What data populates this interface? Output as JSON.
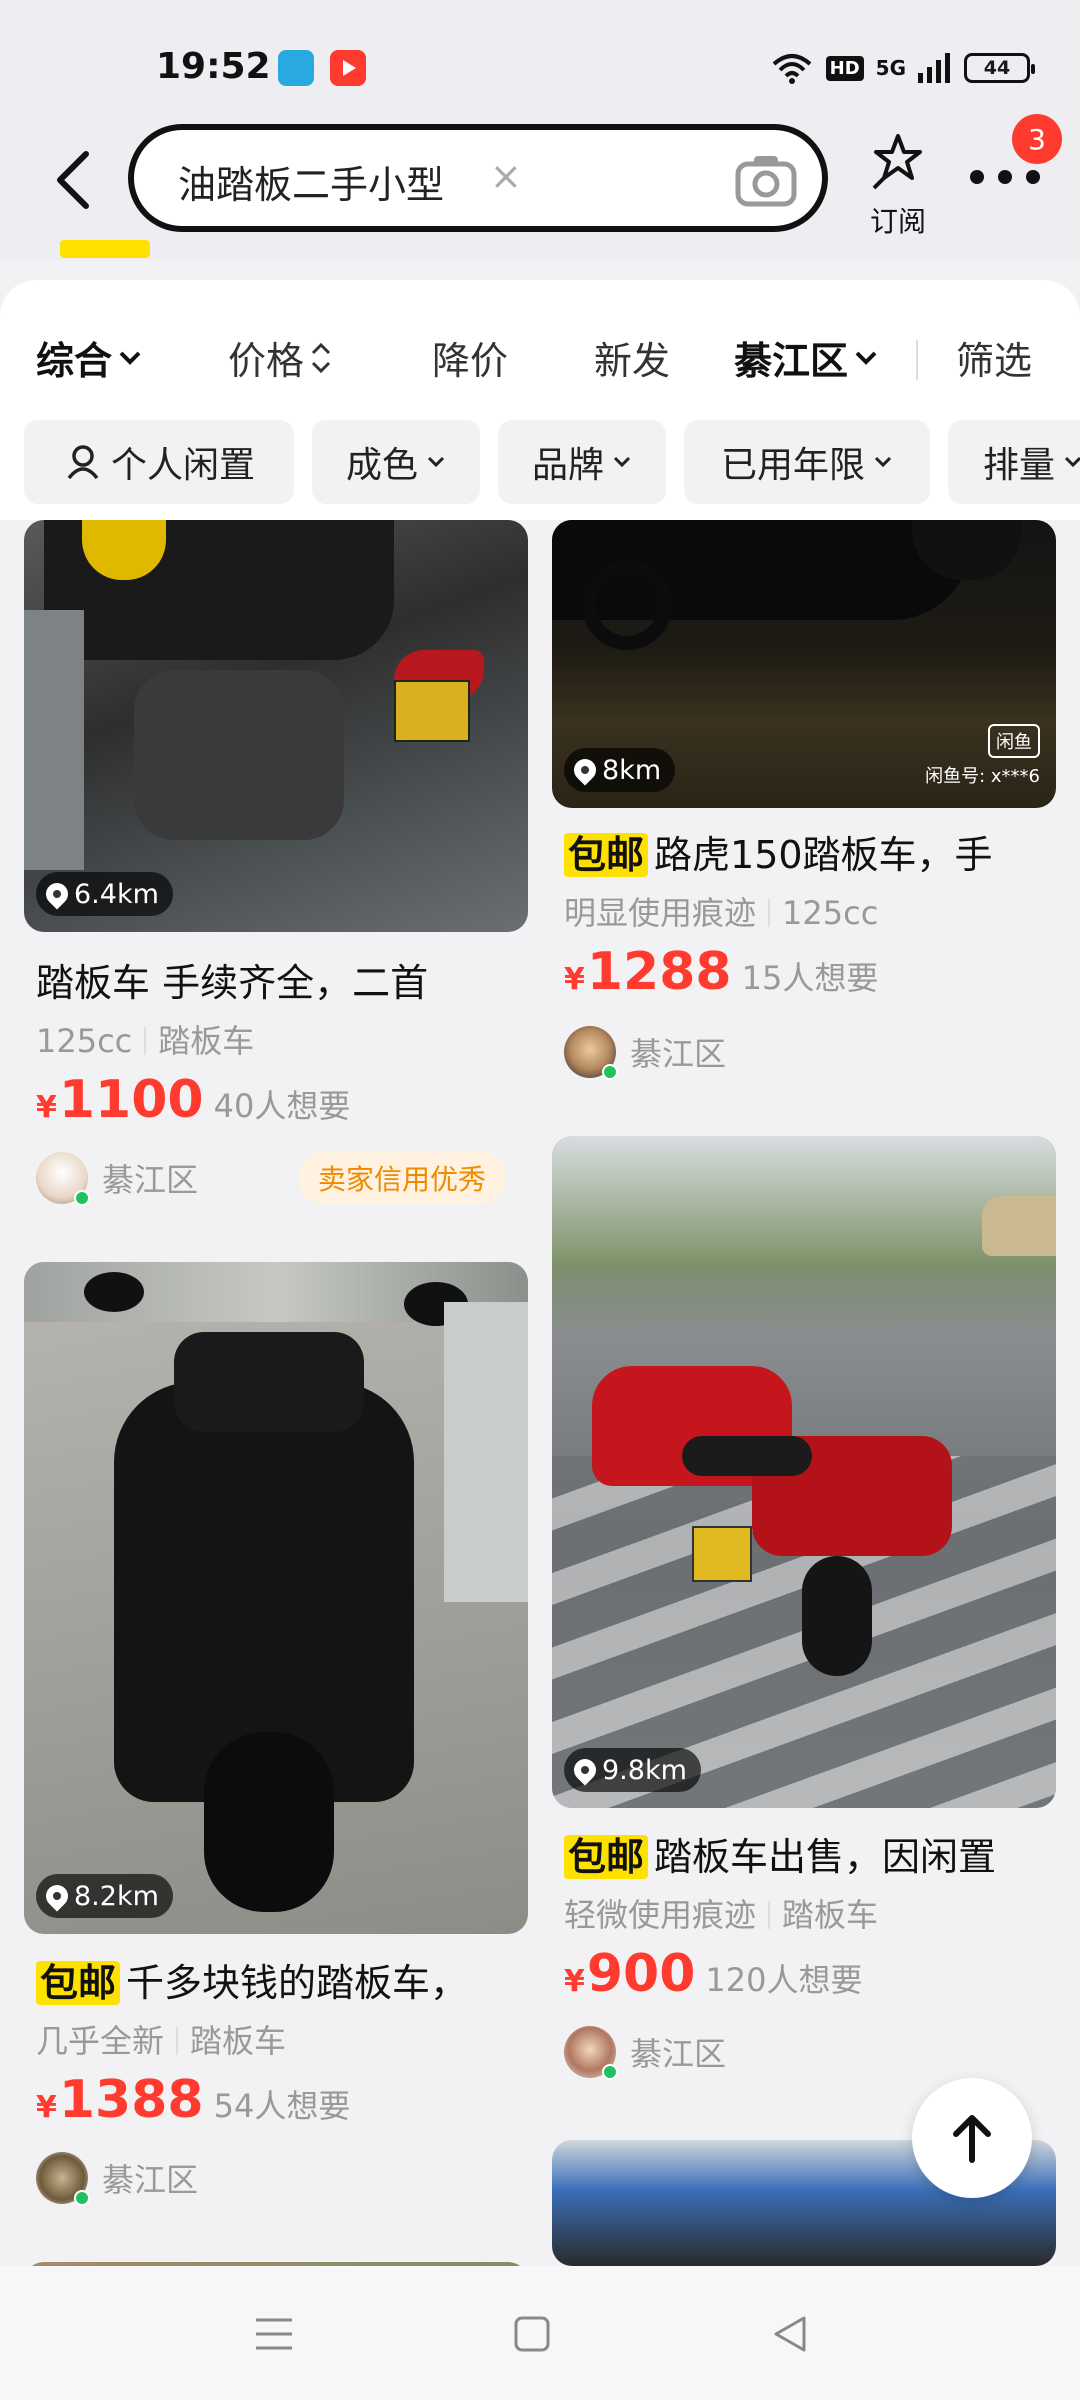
{
  "status_bar": {
    "time": "19:52",
    "network": "5G",
    "hd_label": "HD",
    "battery": "44"
  },
  "header": {
    "search_query": "油踏板二手小型",
    "clear_symbol": "×",
    "subscribe_label": "订阅",
    "notification_count": "3"
  },
  "sort_tabs": [
    {
      "label": "综合",
      "icon": "chevron-down-icon"
    },
    {
      "label": "价格",
      "icon": "sort-updown-icon"
    },
    {
      "label": "降价"
    },
    {
      "label": "新发"
    },
    {
      "label": "綦江区",
      "icon": "chevron-down-icon"
    },
    {
      "label": "筛选"
    }
  ],
  "filter_chips": [
    {
      "label": "个人闲置",
      "icon": "person-icon"
    },
    {
      "label": "成色",
      "icon": "chevron-down-icon"
    },
    {
      "label": "品牌",
      "icon": "chevron-down-icon"
    },
    {
      "label": "已用年限",
      "icon": "chevron-down-icon"
    },
    {
      "label": "排量",
      "icon": "chevron-down-icon"
    }
  ],
  "listings": [
    {
      "distance": "6.4km",
      "title": "踏板车 手续齐全，二首",
      "free_shipping": "",
      "tags": [
        "125cc",
        "踏板车"
      ],
      "currency": "¥",
      "price": "1100",
      "wants": "40人想要",
      "region": "綦江区",
      "badge": "卖家信用优秀"
    },
    {
      "distance": "8km",
      "title": "路虎150踏板车，手",
      "free_shipping": "包邮",
      "tags": [
        "明显使用痕迹",
        "125cc"
      ],
      "currency": "¥",
      "price": "1288",
      "wants": "15人想要",
      "region": "綦江区",
      "watermark_logo": "闲鱼",
      "watermark_text": "闲鱼号: x***6"
    },
    {
      "distance": "8.2km",
      "title": "千多块钱的踏板车，",
      "free_shipping": "包邮",
      "tags": [
        "几乎全新",
        "踏板车"
      ],
      "currency": "¥",
      "price": "1388",
      "wants": "54人想要",
      "region": "綦江区"
    },
    {
      "distance": "9.8km",
      "title": "踏板车出售，因闲置",
      "free_shipping": "包邮",
      "tags": [
        "轻微使用痕迹",
        "踏板车"
      ],
      "currency": "¥",
      "price": "900",
      "wants": "120人想要",
      "region": "綦江区"
    }
  ],
  "colors": {
    "price_red": "#ff3b30",
    "free_ship_yellow": "#ffe100",
    "credit_orange": "#f08a00",
    "online_green": "#21c25e"
  }
}
